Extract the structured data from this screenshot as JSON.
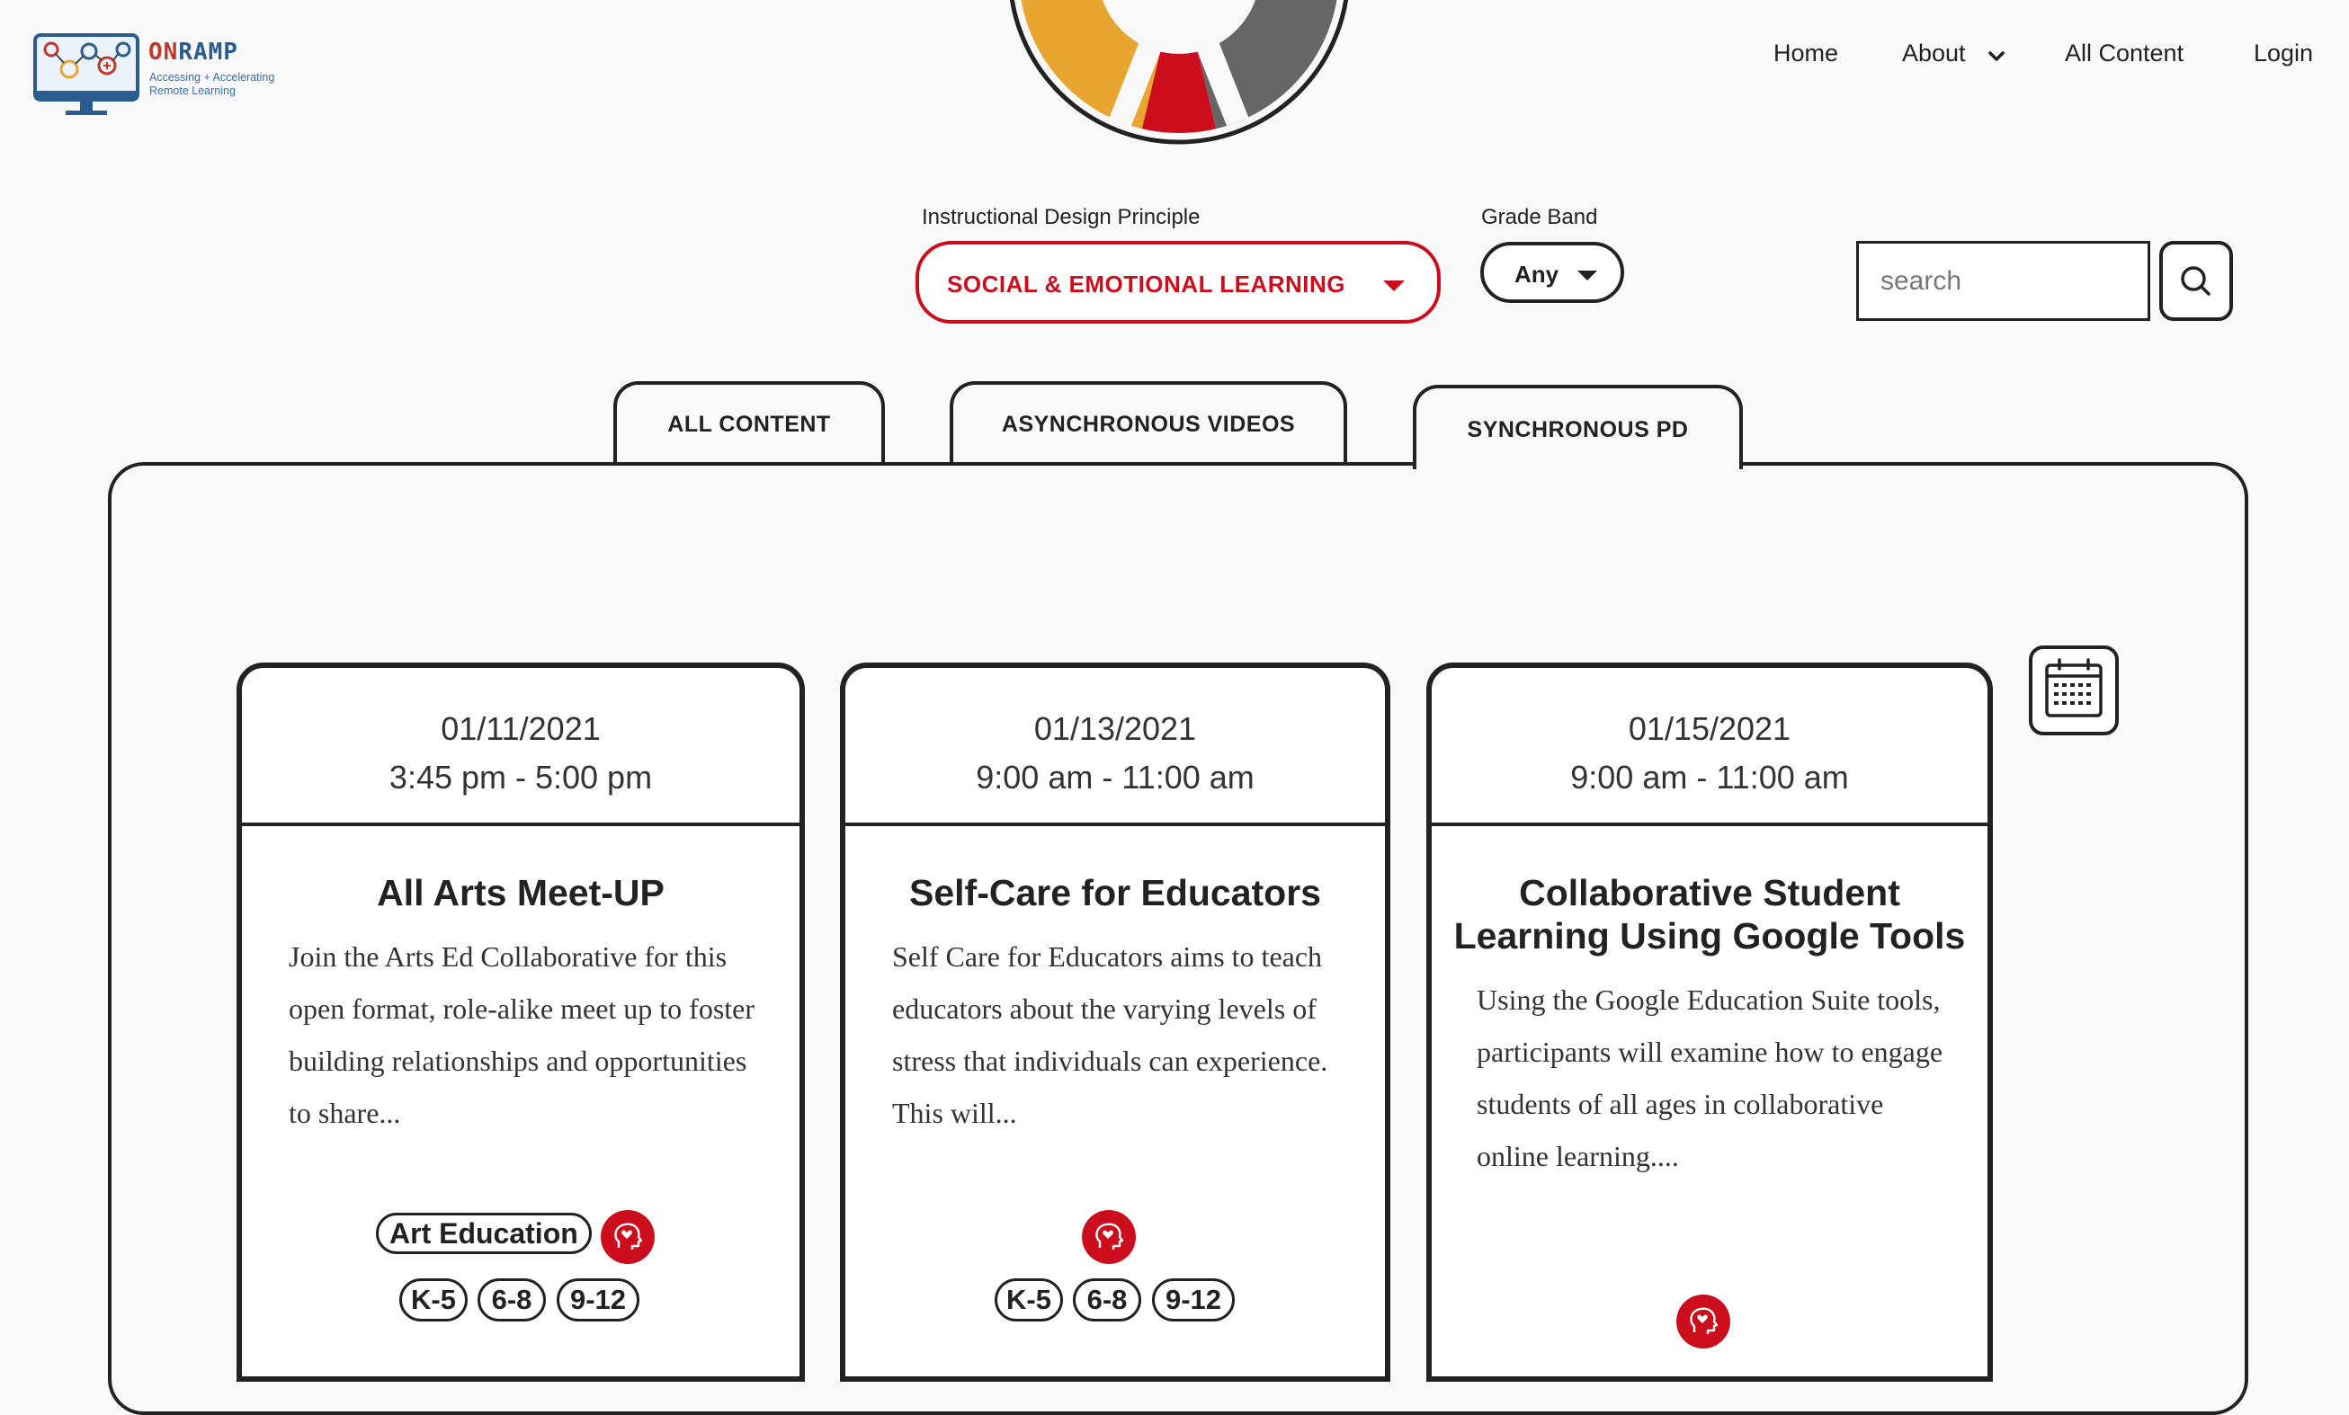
{
  "header": {
    "logo": {
      "brand_primary": "ON",
      "brand_secondary": "RAMP",
      "tagline": "Accessing + Accelerating Remote Learning"
    },
    "nav": {
      "home": "Home",
      "about": "About",
      "all_content": "All Content",
      "login": "Login"
    }
  },
  "filters": {
    "principle_label": "Instructional Design Principle",
    "principle_value": "SOCIAL & EMOTIONAL LEARNING",
    "grade_label": "Grade Band",
    "grade_value": "Any",
    "search_placeholder": "search"
  },
  "tabs": [
    {
      "label": "ALL CONTENT",
      "active": false
    },
    {
      "label": "ASYNCHRONOUS VIDEOS",
      "active": false
    },
    {
      "label": "SYNCHRONOUS PD",
      "active": true
    }
  ],
  "events": [
    {
      "date": "01/11/2021",
      "time": "3:45 pm - 5:00 pm",
      "title": "All Arts Meet-UP",
      "description": "Join the Arts Ed Collaborative for this open format, role-alike meet up to foster building relationships and opportunities to share...",
      "subject": "Art Education",
      "grades": [
        "K-5",
        "6-8",
        "9-12"
      ],
      "principle_icon": "heart-head-icon"
    },
    {
      "date": "01/13/2021",
      "time": "9:00 am - 11:00 am",
      "title": "Self-Care for Educators",
      "description": "Self Care for Educators aims to teach educators about the varying levels of stress that individuals can experience. This will...",
      "grades": [
        "K-5",
        "6-8",
        "9-12"
      ],
      "principle_icon": "heart-head-icon"
    },
    {
      "date": "01/15/2021",
      "time": "9:00 am - 11:00 am",
      "title": "Collaborative Student Learning Using Google Tools",
      "description": "Using the Google Education Suite tools, participants will examine how to engage students of all ages in collaborative online learning....",
      "principle_icon": "heart-head-icon"
    }
  ],
  "colors": {
    "accent_red": "#cc0e1c",
    "wheel_yellow": "#e8a630",
    "wheel_gray": "#666666",
    "text_dark": "#222222"
  }
}
